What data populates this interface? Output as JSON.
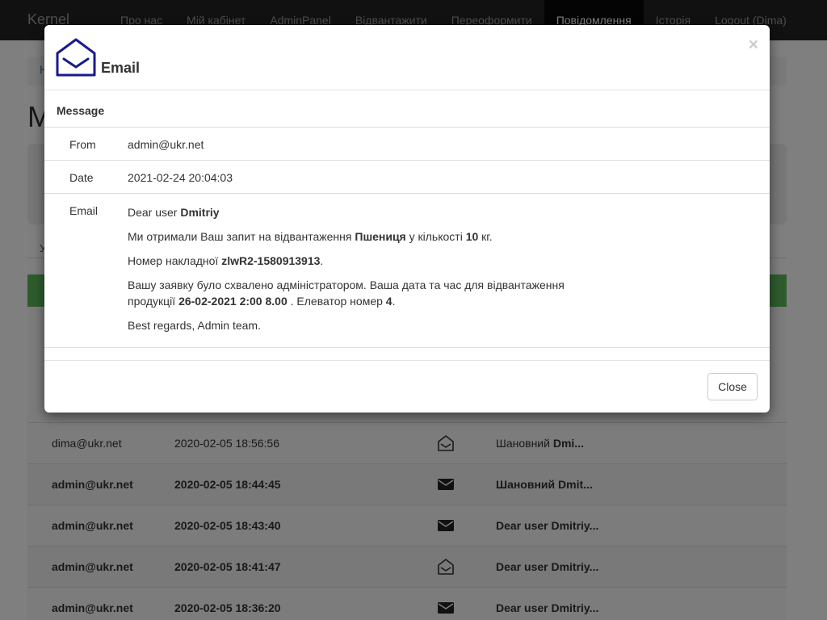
{
  "navbar": {
    "brand": "Kernel",
    "items": [
      "Про нас",
      "Мій кабінет",
      "AdminPanel",
      "Відвантажити",
      "Переоформити",
      "Повідомлення",
      "Історія",
      "Logout (Dima)"
    ],
    "active_index": 5
  },
  "background": {
    "breadcrumb_letter": "Н",
    "page_heading_letter": "М",
    "subnav_letter": "У",
    "rows": [
      {
        "from": "dima@ukr.net",
        "date": "2020-02-05 18:56:56",
        "icon": "envelope-open-icon",
        "subject_prefix": "Шановний ",
        "subject_bold": "Dmi...",
        "unread": false
      },
      {
        "from": "admin@ukr.net",
        "date": "2020-02-05 18:44:45",
        "icon": "envelope-closed-icon",
        "subject_prefix": "",
        "subject_bold": "Шановний Dmit...",
        "unread": true
      },
      {
        "from": "admin@ukr.net",
        "date": "2020-02-05 18:43:40",
        "icon": "envelope-closed-icon",
        "subject_prefix": "",
        "subject_bold": "Dear user Dmitriy...",
        "unread": true
      },
      {
        "from": "admin@ukr.net",
        "date": "2020-02-05 18:41:47",
        "icon": "envelope-open-icon",
        "subject_prefix": "",
        "subject_bold": "Dear user Dmitriy...",
        "unread": true
      },
      {
        "from": "admin@ukr.net",
        "date": "2020-02-05 18:36:20",
        "icon": "envelope-closed-icon",
        "subject_prefix": "",
        "subject_bold": "Dear user Dmitriy...",
        "unread": true
      }
    ]
  },
  "modal": {
    "title": "Email",
    "close_x": "×",
    "section_label": "Message",
    "from_label": "From",
    "from_value": "admin@ukr.net",
    "date_label": "Date",
    "date_value": "2021-02-24 20:04:03",
    "email_label": "Email",
    "email": {
      "greeting": "Dear user ",
      "greeting_name": "Dmitriy",
      "p1_a": "Ми отримали Ваш запит на відвантаження ",
      "p1_product": "Пшениця",
      "p1_b": " у кількості ",
      "p1_qty": "10",
      "p1_c": " кг.",
      "p2_a": "Номер накладної ",
      "p2_invoice": "zlwR2-1580913913",
      "p2_b": ".",
      "p3_a": "Вашу заявку було схвалено адміністратором. Ваша дата та час для відвантаження продукції ",
      "p3_datetime": "26-02-2021 2:00 8.00",
      "p3_b": " . Елеватор номер ",
      "p3_elevator": "4",
      "p3_c": ".",
      "signoff": "Best regards, Admin team."
    },
    "close_button": "Close"
  },
  "colors": {
    "navbar_bg": "#222222",
    "table_header_green": "#5cb85c",
    "logo_navy": "#1a1a8c"
  }
}
